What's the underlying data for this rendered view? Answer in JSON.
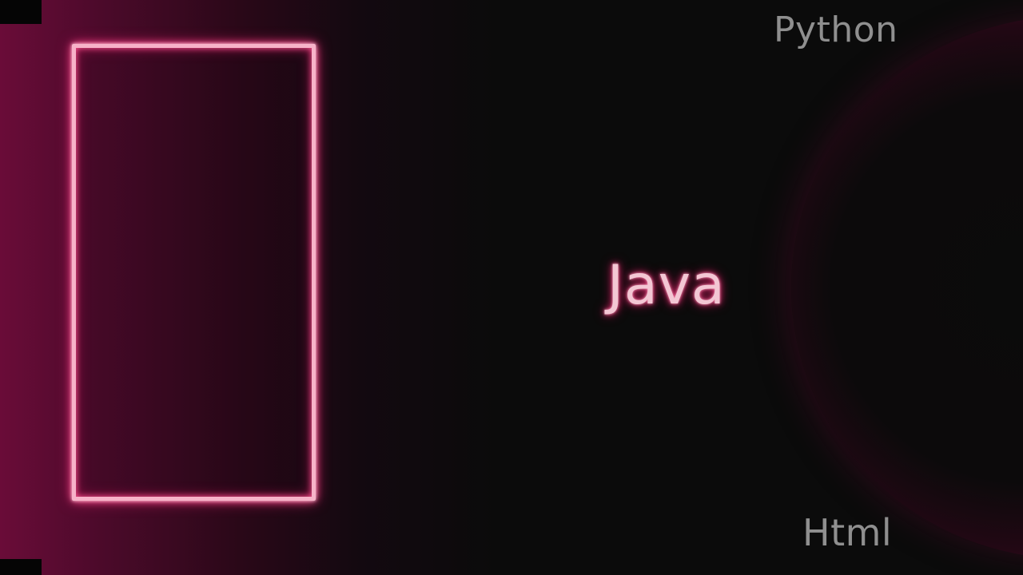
{
  "labels": {
    "python": "Python",
    "java": "Java",
    "html": "Html"
  },
  "colors": {
    "background": "#0b0b0b",
    "gradient_magenta": "#6a0c38",
    "neon_frame": "#f7b3c9",
    "neon_glow": "#d01f64",
    "java_text": "#f3c7d4",
    "gray_text": "#8f8f8f"
  },
  "icons": {
    "frame": "neon-rectangle-frame",
    "orb": "dark-crimson-circle"
  }
}
